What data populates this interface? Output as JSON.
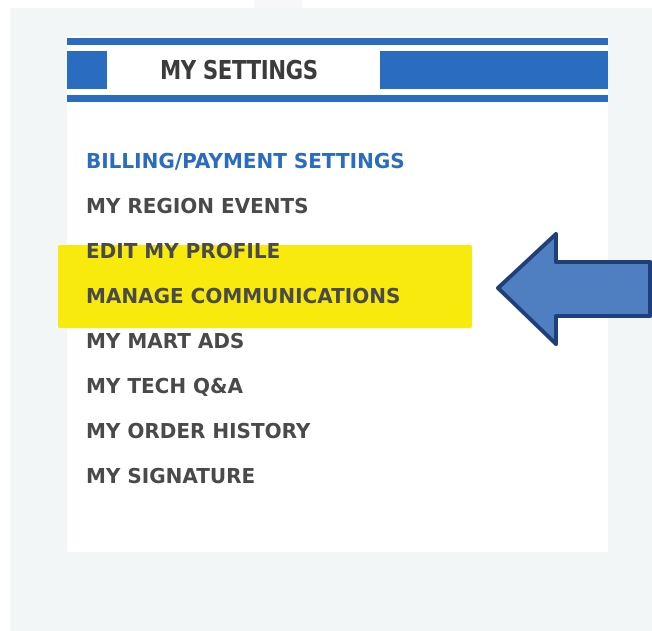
{
  "panel": {
    "title": "MY SETTINGS",
    "accent_color": "#2a6cc0",
    "highlight_color": "#f7ea0c"
  },
  "menu": {
    "items": [
      {
        "label": "BILLING/PAYMENT SETTINGS",
        "active": true
      },
      {
        "label": "MY REGION EVENTS"
      },
      {
        "label": "EDIT MY PROFILE"
      },
      {
        "label": "MANAGE COMMUNICATIONS",
        "highlighted": true
      },
      {
        "label": "MY MART ADS"
      },
      {
        "label": "MY TECH Q&A"
      },
      {
        "label": "MY ORDER HISTORY"
      },
      {
        "label": "MY SIGNATURE"
      }
    ]
  },
  "annotation": {
    "icon": "arrow-left-icon",
    "color": "#4f7fc0"
  }
}
